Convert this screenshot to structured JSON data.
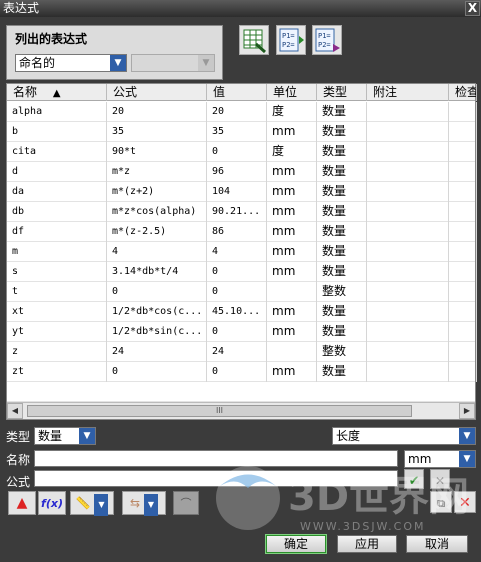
{
  "window": {
    "title": "表达式",
    "close_glyph": "X"
  },
  "listed": {
    "title": "列出的表达式",
    "filter_value": "命名的",
    "secondary_value": ""
  },
  "toolbar_icons": [
    "spreadsheet-icon",
    "import-p1p2-icon",
    "export-p1p2-icon"
  ],
  "toolbar_labels": {
    "p1": "P1=",
    "p2": "P2="
  },
  "table": {
    "columns": [
      "名称",
      "公式",
      "值",
      "单位",
      "类型",
      "附注",
      "检查"
    ],
    "sort_glyph": "▲",
    "rows": [
      [
        "alpha",
        "20",
        "20",
        "度",
        "数量"
      ],
      [
        "b",
        "35",
        "35",
        "mm",
        "数量"
      ],
      [
        "cita",
        "90*t",
        "0",
        "度",
        "数量"
      ],
      [
        "d",
        "m*z",
        "96",
        "mm",
        "数量"
      ],
      [
        "da",
        "m*(z+2)",
        "104",
        "mm",
        "数量"
      ],
      [
        "db",
        "m*z*cos(alpha)",
        "90.21...",
        "mm",
        "数量"
      ],
      [
        "df",
        "m*(z-2.5)",
        "86",
        "mm",
        "数量"
      ],
      [
        "m",
        "4",
        "4",
        "mm",
        "数量"
      ],
      [
        "s",
        "3.14*db*t/4",
        "0",
        "mm",
        "数量"
      ],
      [
        "t",
        "0",
        "0",
        "",
        "整数"
      ],
      [
        "xt",
        "1/2*db*cos(c...",
        "45.10...",
        "mm",
        "数量"
      ],
      [
        "yt",
        "1/2*db*sin(c...",
        "0",
        "mm",
        "数量"
      ],
      [
        "z",
        "24",
        "24",
        "",
        "整数"
      ],
      [
        "zt",
        "0",
        "0",
        "mm",
        "数量"
      ]
    ],
    "scroll_thumb_glyph": "III",
    "scroll_left_glyph": "◀",
    "scroll_right_glyph": "▶"
  },
  "form": {
    "type_label": "类型",
    "type_value": "数量",
    "dimension_value": "长度",
    "name_label": "名称",
    "name_value": "",
    "unit_value": "mm",
    "formula_label": "公式",
    "formula_value": ""
  },
  "tools": {
    "fx_label": "f(x)"
  },
  "buttons": {
    "ok": "确定",
    "apply": "应用",
    "cancel": "取消"
  },
  "watermark": {
    "brand": "3D世界网",
    "url": "WWW.3DSJW.COM"
  },
  "colors": {
    "accent": "#2f5fa8",
    "title_bg": "#3c3c3c",
    "ok_border": "#2b8f2b"
  }
}
